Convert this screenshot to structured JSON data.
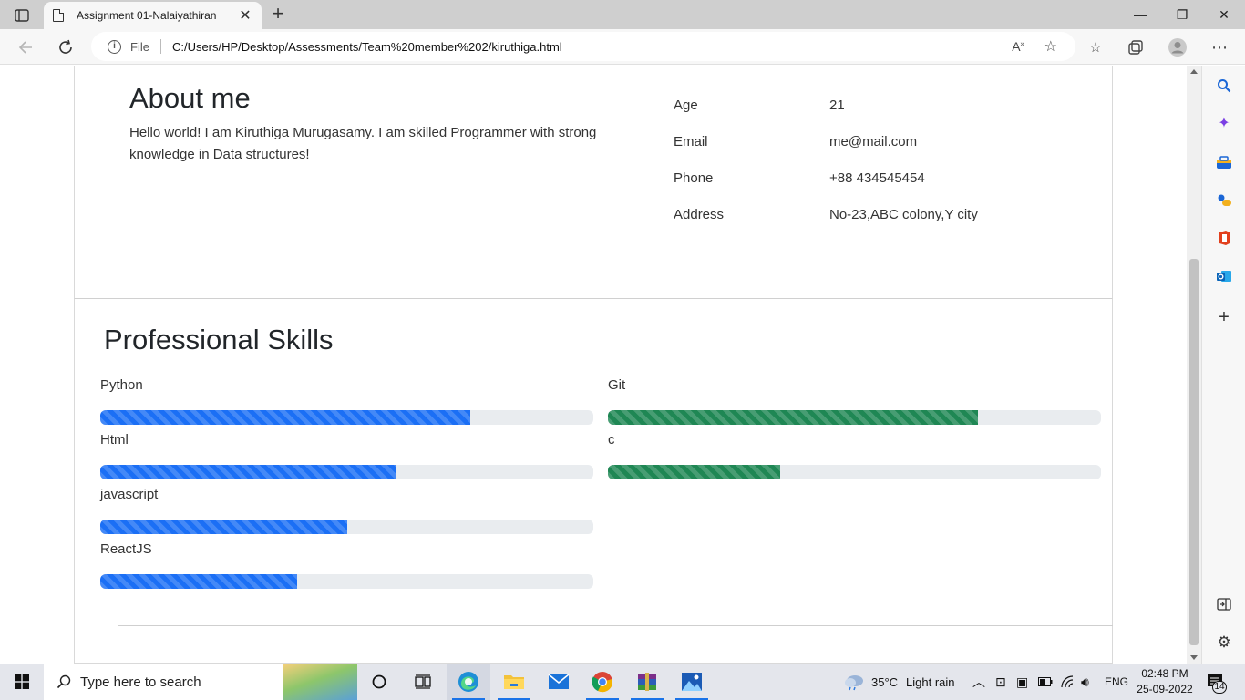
{
  "browser": {
    "tab_title": "Assignment 01-Nalaiyathiran",
    "address_scheme_label": "File",
    "url": "C:/Users/HP/Desktop/Assessments/Team%20member%202/kiruthiga.html"
  },
  "about": {
    "heading": "About me",
    "text": "Hello world! I am Kiruthiga Murugasamy. I am skilled Programmer with strong knowledge in Data structures!",
    "rows": [
      {
        "label": "Age",
        "value": "21"
      },
      {
        "label": "Email",
        "value": "me@mail.com"
      },
      {
        "label": "Phone",
        "value": "+88 434545454"
      },
      {
        "label": "Address",
        "value": "No-23,ABC colony,Y city"
      }
    ]
  },
  "skills": {
    "heading": "Professional Skills",
    "left": [
      {
        "name": "Python",
        "level": 75,
        "color": "#1b6ff5"
      },
      {
        "name": "Html",
        "level": 60,
        "color": "#1b6ff5"
      },
      {
        "name": "javascript",
        "level": 50,
        "color": "#1b6ff5"
      },
      {
        "name": "ReactJS",
        "level": 40,
        "color": "#1b6ff5"
      }
    ],
    "right": [
      {
        "name": "Git",
        "level": 75,
        "color": "#1f8754"
      },
      {
        "name": "c",
        "level": 35,
        "color": "#1f8754"
      }
    ]
  },
  "taskbar": {
    "search_placeholder": "Type here to search",
    "weather_temp": "35°C",
    "weather_text": "Light rain",
    "language": "ENG",
    "time": "02:48 PM",
    "date": "25-09-2022",
    "notifications": "14"
  }
}
